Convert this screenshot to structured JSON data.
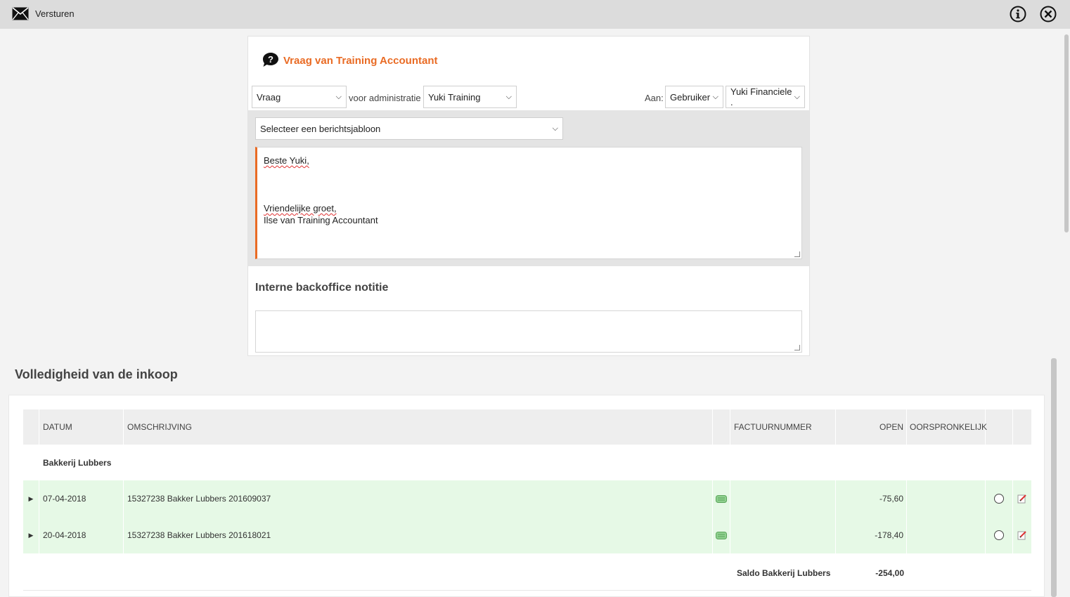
{
  "topbar": {
    "title": "Versturen"
  },
  "icons": {
    "mail": "envelope-icon",
    "info": "info-icon",
    "close": "close-icon",
    "question": "question-bubble-icon",
    "edit": "edit-pencil-icon",
    "money": "money-note-icon"
  },
  "panel": {
    "title": "Vraag van Training Accountant",
    "type_select": "Vraag",
    "admin_label": "voor administratie",
    "admin_select": "Yuki Training",
    "to_label": "Aan:",
    "to_select": "Gebruiker",
    "recipient_select": "Yuki Financiele .",
    "template_select": "Selecteer een berichtsjabloon",
    "message": {
      "greeting": "Beste Yuki,",
      "closing": "Vriendelijke groet,",
      "signature": "Ilse van Training Accountant"
    },
    "note_title": "Interne backoffice notitie"
  },
  "section": {
    "title": "Volledigheid van de inkoop"
  },
  "table": {
    "headers": {
      "date": "DATUM",
      "description": "OMSCHRIJVING",
      "invoice": "FACTUURNUMMER",
      "open": "OPEN",
      "original": "OORSPRONKELIJK"
    },
    "group": "Bakkerij Lubbers",
    "rows": [
      {
        "date": "07-04-2018",
        "description": "15327238 Bakker Lubbers 201609037",
        "invoice": "",
        "open": "-75,60",
        "original": ""
      },
      {
        "date": "20-04-2018",
        "description": "15327238 Bakker Lubbers 201618021",
        "invoice": "",
        "open": "-178,40",
        "original": ""
      }
    ],
    "saldo_label": "Saldo Bakkerij Lubbers",
    "saldo_value": "-254,00"
  },
  "colors": {
    "accent": "#e96b24",
    "row_bg": "#e6f9e6",
    "topbar": "#dcdcdc"
  }
}
